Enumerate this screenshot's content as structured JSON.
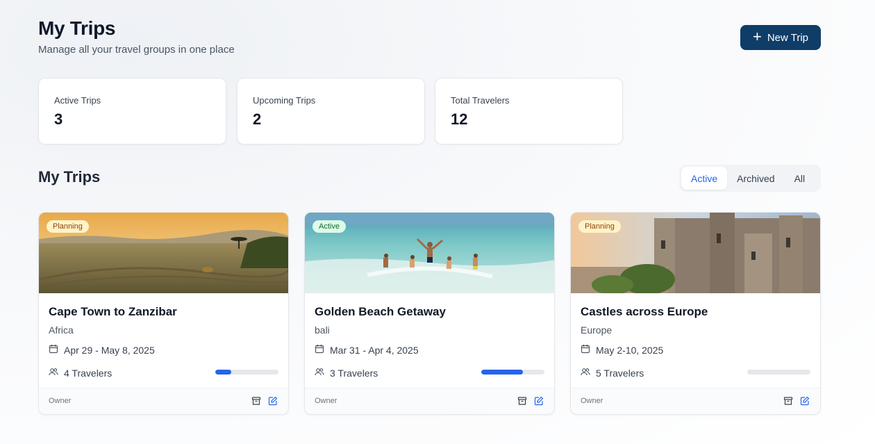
{
  "header": {
    "title": "My Trips",
    "subtitle": "Manage all your travel groups in one place",
    "new_trip_label": "New Trip"
  },
  "stats": [
    {
      "label": "Active Trips",
      "value": "3"
    },
    {
      "label": "Upcoming Trips",
      "value": "2"
    },
    {
      "label": "Total Travelers",
      "value": "12"
    }
  ],
  "section": {
    "title": "My Trips",
    "filters": [
      {
        "label": "Active",
        "selected": true
      },
      {
        "label": "Archived",
        "selected": false
      },
      {
        "label": "All",
        "selected": false
      }
    ]
  },
  "colors": {
    "accent": "#2563eb",
    "primary_button": "#0f3d67",
    "badge_planning_bg": "#fef3c7",
    "badge_planning_text": "#92400e",
    "badge_active_bg": "#dcfce7",
    "badge_active_text": "#166534"
  },
  "trips": [
    {
      "status": "Planning",
      "title": "Cape Town to Zanzibar",
      "location": "Africa",
      "dates": "Apr 29 - May 8, 2025",
      "travelers": "4 Travelers",
      "progress": 0.25,
      "role": "Owner",
      "image_icon": "savanna-photo"
    },
    {
      "status": "Active",
      "title": "Golden Beach Getaway",
      "location": "bali",
      "dates": "Mar 31 - Apr 4, 2025",
      "travelers": "3 Travelers",
      "progress": 0.66,
      "role": "Owner",
      "image_icon": "beach-photo"
    },
    {
      "status": "Planning",
      "title": "Castles across Europe",
      "location": "Europe",
      "dates": "May 2-10, 2025",
      "travelers": "5 Travelers",
      "progress": 0,
      "role": "Owner",
      "image_icon": "castle-photo"
    }
  ]
}
